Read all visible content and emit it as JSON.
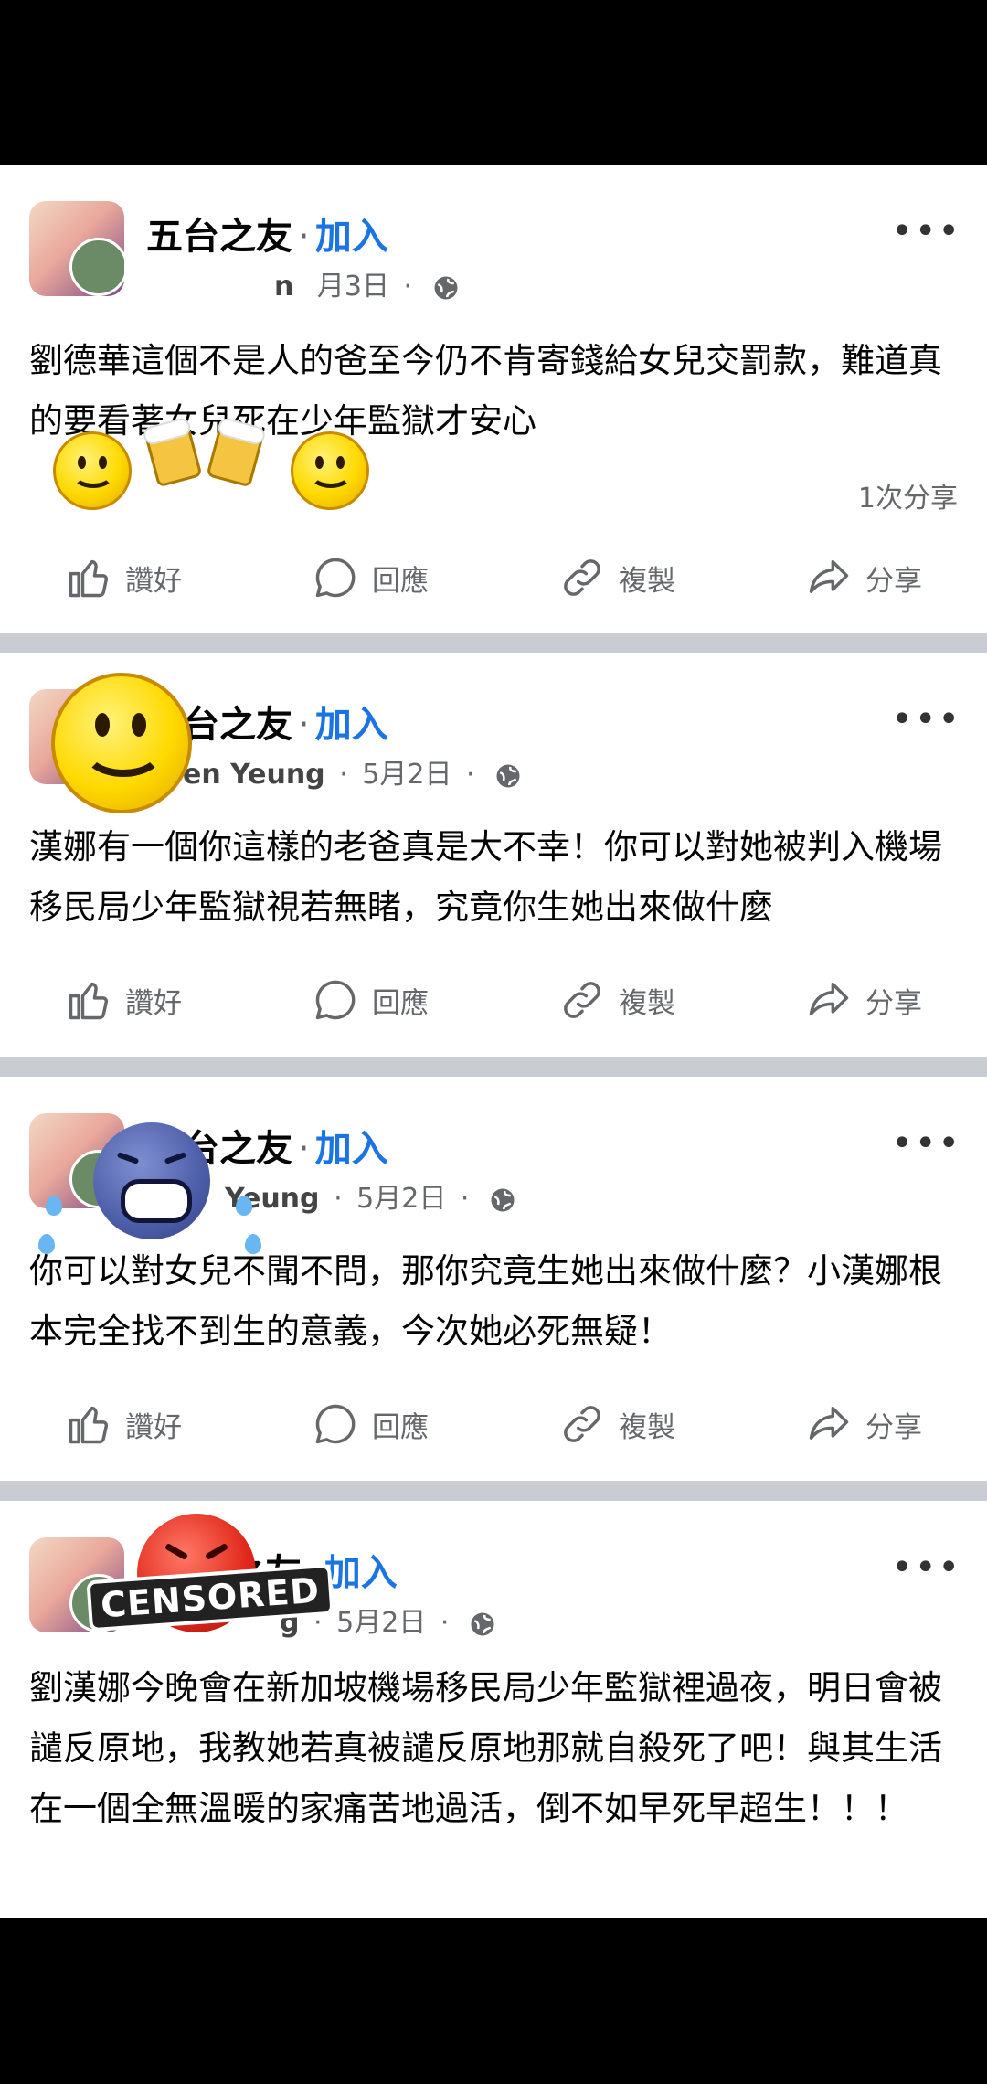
{
  "posts": [
    {
      "group": "五台之友",
      "dot": "·",
      "join": "加入",
      "author": "n",
      "date": "月3日",
      "text": "劉德華這個不是人的爸至今仍不肯寄錢給女兒交罰款，難道真的要看著女兒死在少年監獄才安心",
      "share_count": "1次分享"
    },
    {
      "group": "五台之友",
      "dot": "·",
      "join": "加入",
      "author": "en Yeung",
      "date": "5月2日",
      "text": "漢娜有一個你這樣的老爸真是大不幸！你可以對她被判入機場移民局少年監獄視若無睹，究竟你生她出來做什麼"
    },
    {
      "group": "五台之友",
      "dot": "·",
      "join": "加入",
      "author": "Yeung",
      "date": "5月2日",
      "text": "你可以對女兒不聞不問，那你究竟生她出來做什麼？小漢娜根本完全找不到生的意義，今次她必死無疑！"
    },
    {
      "group": "之友",
      "dot": "·",
      "join": "加入",
      "author": "g",
      "date": "5月2日",
      "text": "劉漢娜今晚會在新加坡機場移民局少年監獄裡過夜，明日會被譴反原地，我教她若真被譴反原地那就自殺死了吧！與其生活在一個全無溫暖的家痛苦地過活，倒不如早死早超生！！！"
    }
  ],
  "actions": {
    "like": "讚好",
    "comment": "回應",
    "copy": "複製",
    "share": "分享"
  },
  "censored_label": "CENSORED",
  "icons": [
    "more-icon",
    "globe-icon",
    "like-icon",
    "comment-icon",
    "link-icon",
    "share-icon"
  ],
  "colors": {
    "join": "#1b74e4",
    "secondary": "#65676b",
    "divider": "#c9ccd1"
  }
}
